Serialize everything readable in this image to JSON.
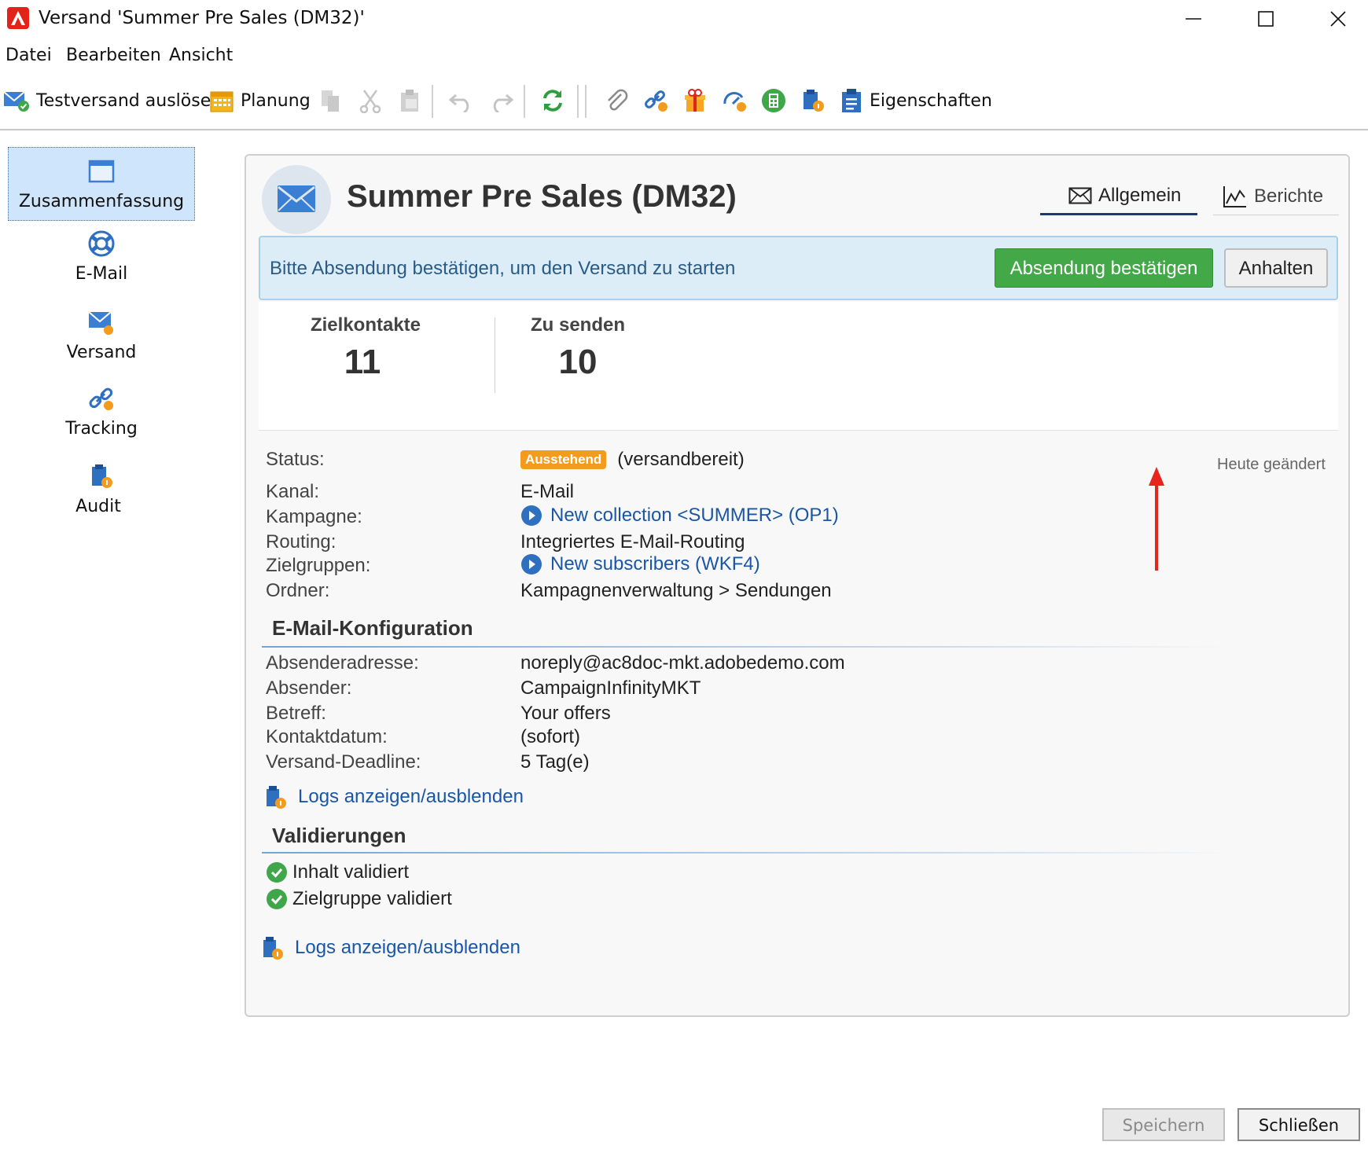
{
  "window": {
    "title": "Versand 'Summer Pre Sales (DM32)'"
  },
  "menu": {
    "items": [
      "Datei",
      "Bearbeiten",
      "Ansicht"
    ]
  },
  "toolbar": {
    "test_send_label": "Testversand auslösen",
    "schedule_label": "Planung",
    "properties_label": "Eigenschaften"
  },
  "nav": {
    "items": [
      {
        "label": "Zusammenfassung",
        "icon": "summary-icon",
        "active": true
      },
      {
        "label": "E-Mail",
        "icon": "email-lifebuoy-icon"
      },
      {
        "label": "Versand",
        "icon": "delivery-icon"
      },
      {
        "label": "Tracking",
        "icon": "tracking-icon"
      },
      {
        "label": "Audit",
        "icon": "audit-icon"
      }
    ]
  },
  "header": {
    "title": "Summer Pre Sales (DM32)",
    "tabs": [
      {
        "label": "Allgemein",
        "active": true
      },
      {
        "label": "Berichte"
      }
    ]
  },
  "banner": {
    "message": "Bitte Absendung bestätigen, um den Versand zu starten",
    "confirm_label": "Absendung bestätigen",
    "hold_label": "Anhalten"
  },
  "stats": [
    {
      "label": "Zielkontakte",
      "value": "11"
    },
    {
      "label": "Zu senden",
      "value": "10"
    }
  ],
  "details": {
    "status_label": "Status:",
    "status_badge": "Ausstehend",
    "status_text": "(versandbereit)",
    "modified": "Heute geändert",
    "rows": [
      {
        "label": "Kanal:",
        "value": "E-Mail"
      },
      {
        "label": "Kampagne:",
        "value": "New collection <SUMMER> (OP1)"
      },
      {
        "label": "Routing:",
        "value": "Integriertes E-Mail-Routing"
      },
      {
        "label": "Zielgruppen:",
        "value": "New subscribers (WKF4)"
      },
      {
        "label": "Ordner:",
        "value": "Kampagnenverwaltung > Sendungen"
      }
    ]
  },
  "email_config": {
    "title": "E-Mail-Konfiguration",
    "rows": [
      {
        "label": "Absenderadresse:",
        "value": "noreply@ac8doc-mkt.adobedemo.com"
      },
      {
        "label": "Absender:",
        "value": "CampaignInfinityMKT"
      },
      {
        "label": "Betreff:",
        "value": "Your offers"
      },
      {
        "label": "Kontaktdatum:",
        "value": "(sofort)"
      },
      {
        "label": "Versand-Deadline:",
        "value": "5 Tag(e)"
      }
    ],
    "logs_link": "Logs anzeigen/ausblenden"
  },
  "validations": {
    "title": "Validierungen",
    "items": [
      "Inhalt validiert",
      "Zielgruppe validiert"
    ],
    "logs_link": "Logs anzeigen/ausblenden"
  },
  "footer": {
    "save_label": "Speichern",
    "close_label": "Schließen"
  },
  "colors": {
    "accent": "#43a847",
    "badge": "#f29b1d",
    "link": "#1a56a7",
    "banner_bg": "#dcedf7",
    "logo": "#e2231a"
  }
}
